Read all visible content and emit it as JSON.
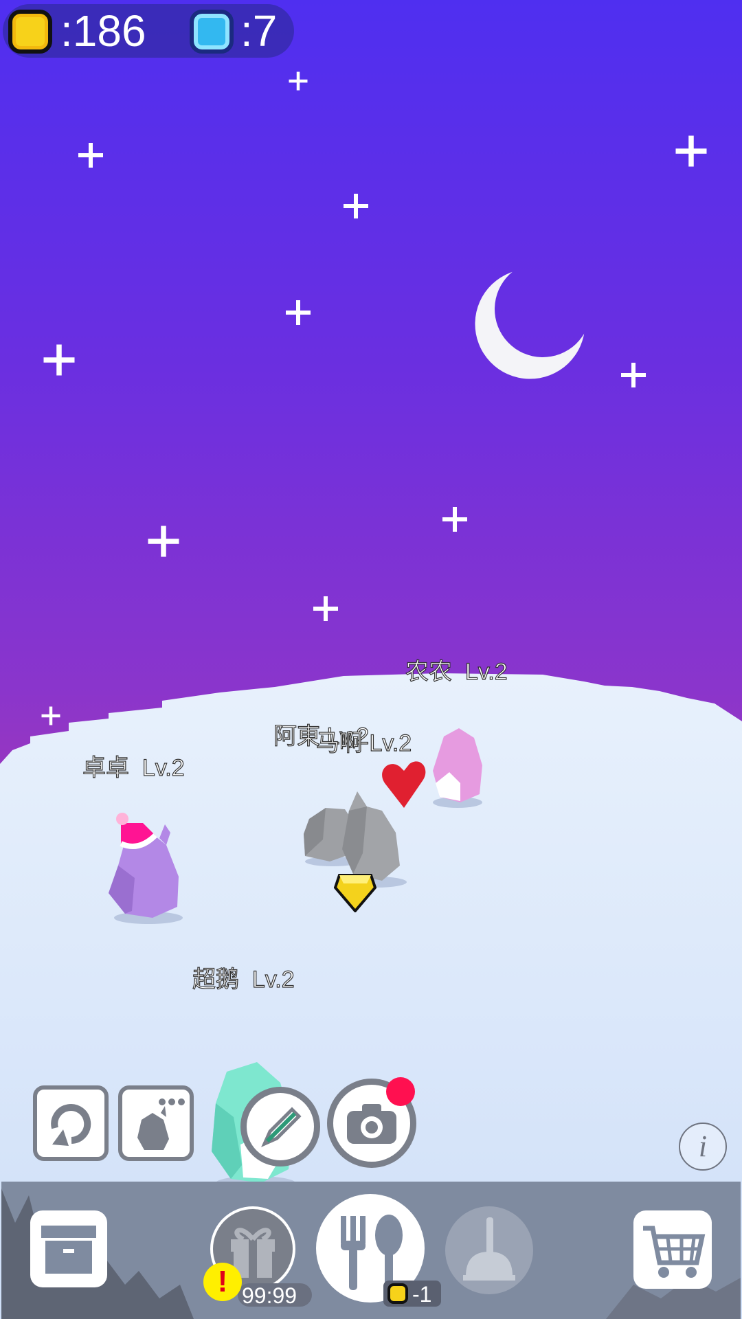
{
  "currency": {
    "coins": ":186",
    "gems": ":7",
    "coin_icon": "gold-coin-icon",
    "gem_icon": "blue-gem-icon"
  },
  "penguins": [
    {
      "name": "农农",
      "level": "Lv.2"
    },
    {
      "name": "阿東",
      "level": "Lv.2"
    },
    {
      "name": "马啊",
      "level": "Lv.2"
    },
    {
      "name": "卓卓",
      "level": "Lv.2"
    },
    {
      "name": "超鹅",
      "level": "Lv.2"
    }
  ],
  "actions": {
    "rotate_icon": "rotate-icon",
    "penguin_menu_icon": "penguin-menu-icon",
    "edit_icon": "pencil-icon",
    "camera_icon": "camera-icon",
    "info_label": "i"
  },
  "bottom_bar": {
    "gift_timer": "99:99",
    "feed_cost": "-1",
    "alert_label": "!",
    "storage_icon": "storage-box-icon",
    "gift_icon": "gift-icon",
    "feed_icon": "fork-spoon-icon",
    "clean_icon": "plunger-icon",
    "shop_icon": "shopping-cart-icon"
  },
  "colors": {
    "sky_top": "#4f2ff0",
    "sky_bottom": "#c04090",
    "snow": "#dbe8fb",
    "bottom_bar": "#7f8ba0",
    "notification": "#ff1050",
    "alert": "#ffef00"
  }
}
